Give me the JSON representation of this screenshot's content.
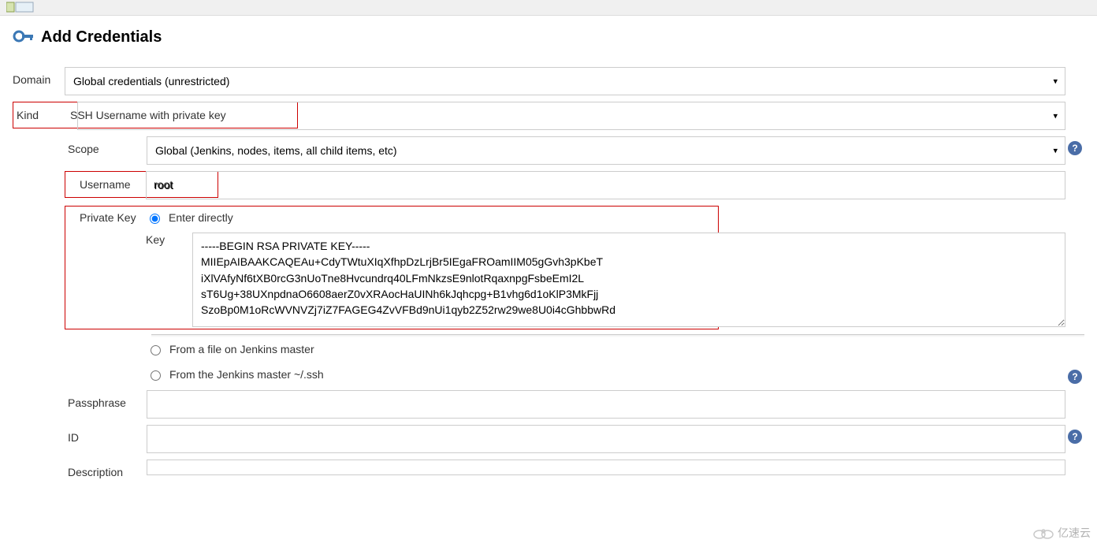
{
  "page": {
    "title": "Add Credentials"
  },
  "form": {
    "domain_label": "Domain",
    "domain_value": "Global credentials (unrestricted)",
    "kind_label": "Kind",
    "kind_value": "SSH Username with private key",
    "scope_label": "Scope",
    "scope_value": "Global (Jenkins, nodes, items, all child items, etc)",
    "username_label": "Username",
    "username_value": "root",
    "private_key_label": "Private Key",
    "pk_radio": {
      "enter_directly": "Enter directly",
      "from_file": "From a file on Jenkins master",
      "from_ssh": "From the Jenkins master ~/.ssh"
    },
    "key_label": "Key",
    "key_value": "-----BEGIN RSA PRIVATE KEY-----\nMIIEpAIBAAKCAQEAu+CdyTWtuXIqXfhpDzLrjBr5IEgaFROamIIM05gGvh3pKbeT\niXlVAfyNf6tXB0rcG3nUoTne8Hvcundrq40LFmNkzsE9nlotRqaxnpgFsbeEmI2L\nsT6Ug+38UXnpdnaO6608aerZ0vXRAocHaUINh6kJqhcpg+B1vhg6d1oKlP3MkFjj\nSzoBp0M1oRcWVNVZj7iZ7FAGEG4ZvVFBd9nUi1qyb2Z52rw29we8U0i4cGhbbwRd",
    "passphrase_label": "Passphrase",
    "passphrase_value": "",
    "id_label": "ID",
    "id_value": "",
    "description_label": "Description",
    "description_value": ""
  },
  "watermark": {
    "text": "亿速云"
  }
}
